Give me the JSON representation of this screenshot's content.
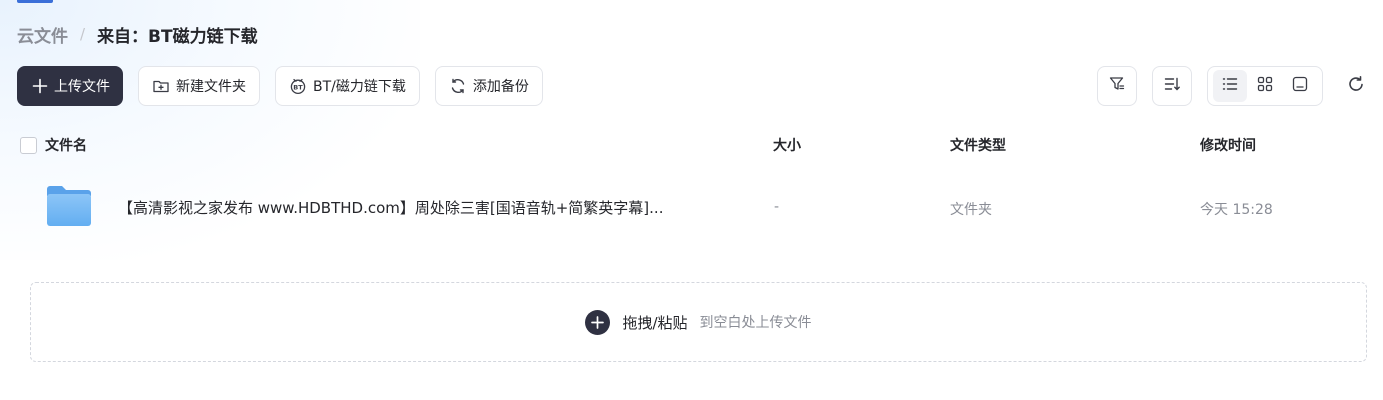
{
  "breadcrumb": {
    "root": "云文件",
    "separator": "/",
    "current": "来自：BT磁力链下载"
  },
  "toolbar": {
    "upload_label": "上传文件",
    "new_folder_label": "新建文件夹",
    "bt_download_label": "BT/磁力链下载",
    "add_backup_label": "添加备份"
  },
  "right_tools": {
    "icons": [
      "filter-icon",
      "sort-icon",
      "list-view-icon",
      "grid-view-icon",
      "thumbnail-view-icon",
      "refresh-icon"
    ],
    "active_view": "list"
  },
  "table": {
    "columns": [
      "文件名",
      "大小",
      "文件类型",
      "修改时间"
    ],
    "rows": [
      {
        "name": "【高清影视之家发布 www.HDBTHD.com】周处除三害[国语音轨+简繁英字幕]...",
        "size": "-",
        "type": "文件夹",
        "modified": "今天 15:28",
        "icon": "folder-icon"
      }
    ]
  },
  "dropzone": {
    "main_label": "拖拽/粘贴",
    "sub_label": "到空白处上传文件"
  },
  "colors": {
    "primary_dark": "#2f3142",
    "folder_blue": "#6fb3f3",
    "muted_text": "#8a8d96",
    "accent": "#3b6fd8"
  }
}
